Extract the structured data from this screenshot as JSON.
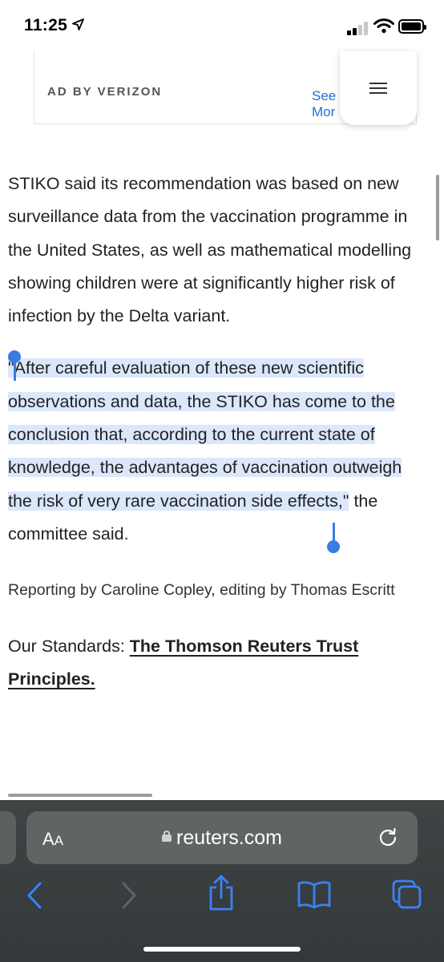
{
  "status_bar": {
    "time": "11:25",
    "location_icon": "location-arrow-icon",
    "signal_icon": "cellular-signal-icon",
    "wifi_icon": "wifi-icon",
    "battery_icon": "battery-icon"
  },
  "ad": {
    "label": "AD BY VERIZON",
    "see_more": "See More"
  },
  "menu": {
    "icon": "hamburger-menu-icon"
  },
  "article": {
    "paragraph1": "STIKO said its recommendation was based on new surveillance data from the vaccination programme in the United States, as well as mathematical modelling showing children were at significantly higher risk of infection by the Delta variant.",
    "quote_open": "\"",
    "quote_selected": "After careful evaluation of these new scientific observations and data, the STIKO has come to the conclusion that, according to the current state of knowledge, the advantages of vaccination outweigh the risk of very rare vaccination side effects,\"",
    "quote_rest": " the committee said.",
    "byline": "Reporting by Caroline Copley, editing by Thomas Escritt",
    "standards_label": "Our Standards: ",
    "standards_link": "The Thomson Reuters Trust Principles."
  },
  "browser": {
    "aa_label_large": "A",
    "aa_label_small": "A",
    "url": "reuters.com",
    "lock_icon": "lock-icon",
    "reload_icon": "reload-icon",
    "toolbar": [
      "back-icon",
      "forward-icon",
      "share-icon",
      "bookmarks-icon",
      "tabs-icon"
    ]
  },
  "colors": {
    "accent": "#1f6fcf",
    "selection": "#dbe7fb",
    "selection_handle": "#3a7ce0",
    "toolbar_background": "#3a3f40"
  }
}
